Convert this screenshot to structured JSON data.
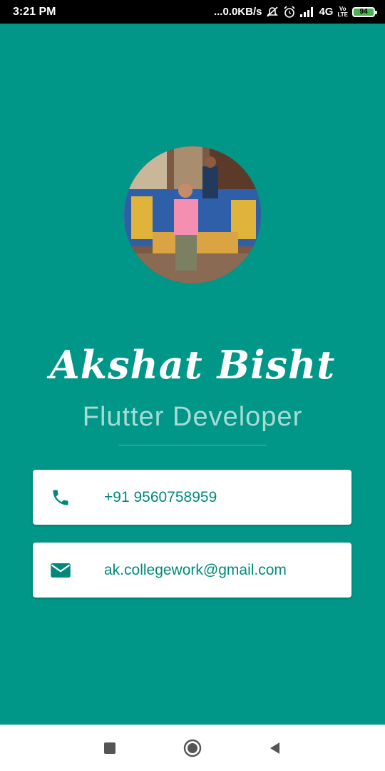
{
  "status_bar": {
    "time": "3:21 PM",
    "network_speed": "...0.0KB/s",
    "network_type": "4G",
    "volte_top": "Vo",
    "volte_bottom": "LTE",
    "battery_level": "94"
  },
  "profile": {
    "name": "Akshat Bisht",
    "title": "Flutter Developer",
    "avatar_icon": "profile-photo"
  },
  "contacts": [
    {
      "icon": "phone-icon",
      "text": "+91 9560758959"
    },
    {
      "icon": "email-icon",
      "text": "ak.collegework@gmail.com"
    }
  ],
  "colors": {
    "background": "#009688",
    "subtitle": "#a7dcd5",
    "accent": "#00897b",
    "battery": "#4caf50"
  },
  "nav": {
    "recent_icon": "square-recent-icon",
    "home_icon": "circle-home-icon",
    "back_icon": "triangle-back-icon"
  }
}
